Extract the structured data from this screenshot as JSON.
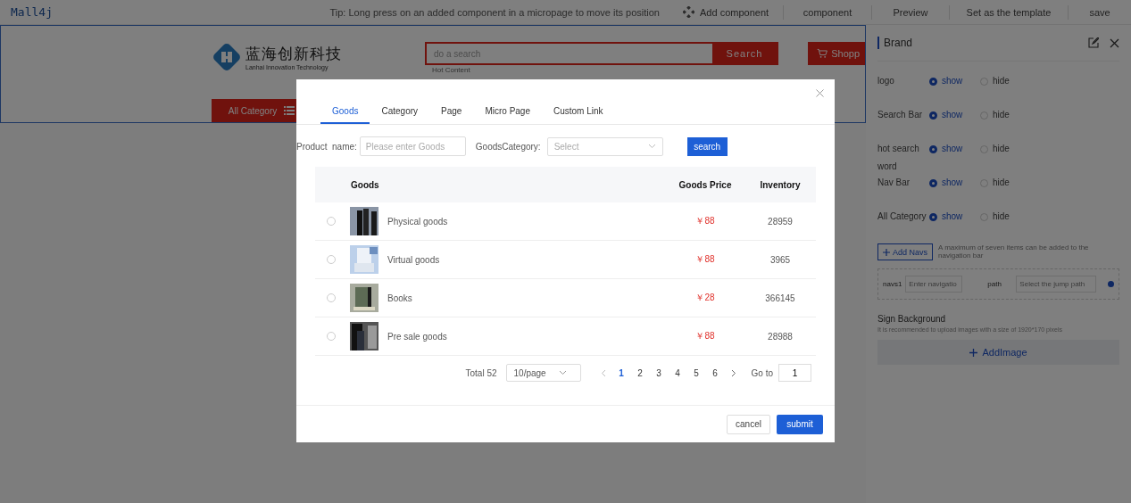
{
  "app": {
    "logo": "Mall4j"
  },
  "toolbar": {
    "tip": "Tip: Long press on an added component in a micropage to move its position",
    "add_component": "Add component",
    "buttons": [
      "component",
      "Preview",
      "Set as the template",
      "save"
    ]
  },
  "canvas": {
    "brand_name": "蓝海创新科技",
    "brand_subtitle": "Lanhai Innovation Technology",
    "search_placeholder": "do a search",
    "search_button": "Search",
    "cart_button": "Shopp",
    "hot_label": "Hot Content",
    "category_button": "All Category"
  },
  "panel": {
    "title": "Brand",
    "settings": [
      {
        "label": "logo",
        "options": [
          {
            "label": "show",
            "selected": true
          },
          {
            "label": "hide",
            "selected": false
          }
        ]
      },
      {
        "label": "Search Bar",
        "options": [
          {
            "label": "show",
            "selected": true
          },
          {
            "label": "hide",
            "selected": false
          }
        ]
      },
      {
        "label": "hot search word",
        "options": [
          {
            "label": "show",
            "selected": true
          },
          {
            "label": "hide",
            "selected": false
          }
        ]
      },
      {
        "label": "Nav Bar",
        "options": [
          {
            "label": "show",
            "selected": true
          },
          {
            "label": "hide",
            "selected": false
          }
        ]
      },
      {
        "label": "All Category",
        "options": [
          {
            "label": "show",
            "selected": true
          },
          {
            "label": "hide",
            "selected": false
          }
        ]
      }
    ],
    "add_navs": "Add Navs",
    "add_navs_note": "A maximum of seven items can be added to the navigation bar",
    "nav": {
      "label": "navs1",
      "placeholder": "Enter navigatio",
      "path_label": "path",
      "path_placeholder": "Select the jump path"
    },
    "sign_title": "Sign Background",
    "sign_hint": "It is recommended to upload images with a size of 1920*170 pixels",
    "add_image": "AddImage"
  },
  "dialog": {
    "tabs": [
      {
        "label": "Goods",
        "selected": true
      },
      {
        "label": "Category",
        "selected": false
      },
      {
        "label": "Page",
        "selected": false
      },
      {
        "label": "Micro Page",
        "selected": false
      },
      {
        "label": "Custom Link",
        "selected": false
      }
    ],
    "filters": {
      "name_label": "Product  name:",
      "name_placeholder": "Please enter Goods",
      "category_label": "GoodsCategory:",
      "category_placeholder": "Select",
      "search_button": "search"
    },
    "columns": [
      "Goods",
      "Goods Price",
      "Inventory"
    ],
    "rows": [
      {
        "name": "Physical goods",
        "price": "￥88",
        "inventory": "28959",
        "selected": false
      },
      {
        "name": "Virtual goods",
        "price": "￥88",
        "inventory": "3965",
        "selected": false
      },
      {
        "name": "Books",
        "price": "￥28",
        "inventory": "366145",
        "selected": false
      },
      {
        "name": "Pre sale goods",
        "price": "￥88",
        "inventory": "28988",
        "selected": false
      }
    ],
    "pagination": {
      "total": "Total 52",
      "page_size": "10/page",
      "pages": [
        {
          "label": "1",
          "selected": true
        },
        {
          "label": "2",
          "selected": false
        },
        {
          "label": "3",
          "selected": false
        },
        {
          "label": "4",
          "selected": false
        },
        {
          "label": "5",
          "selected": false
        },
        {
          "label": "6",
          "selected": false
        }
      ],
      "goto_label": "Go to",
      "goto_value": "1"
    },
    "cancel": "cancel",
    "submit": "submit"
  }
}
